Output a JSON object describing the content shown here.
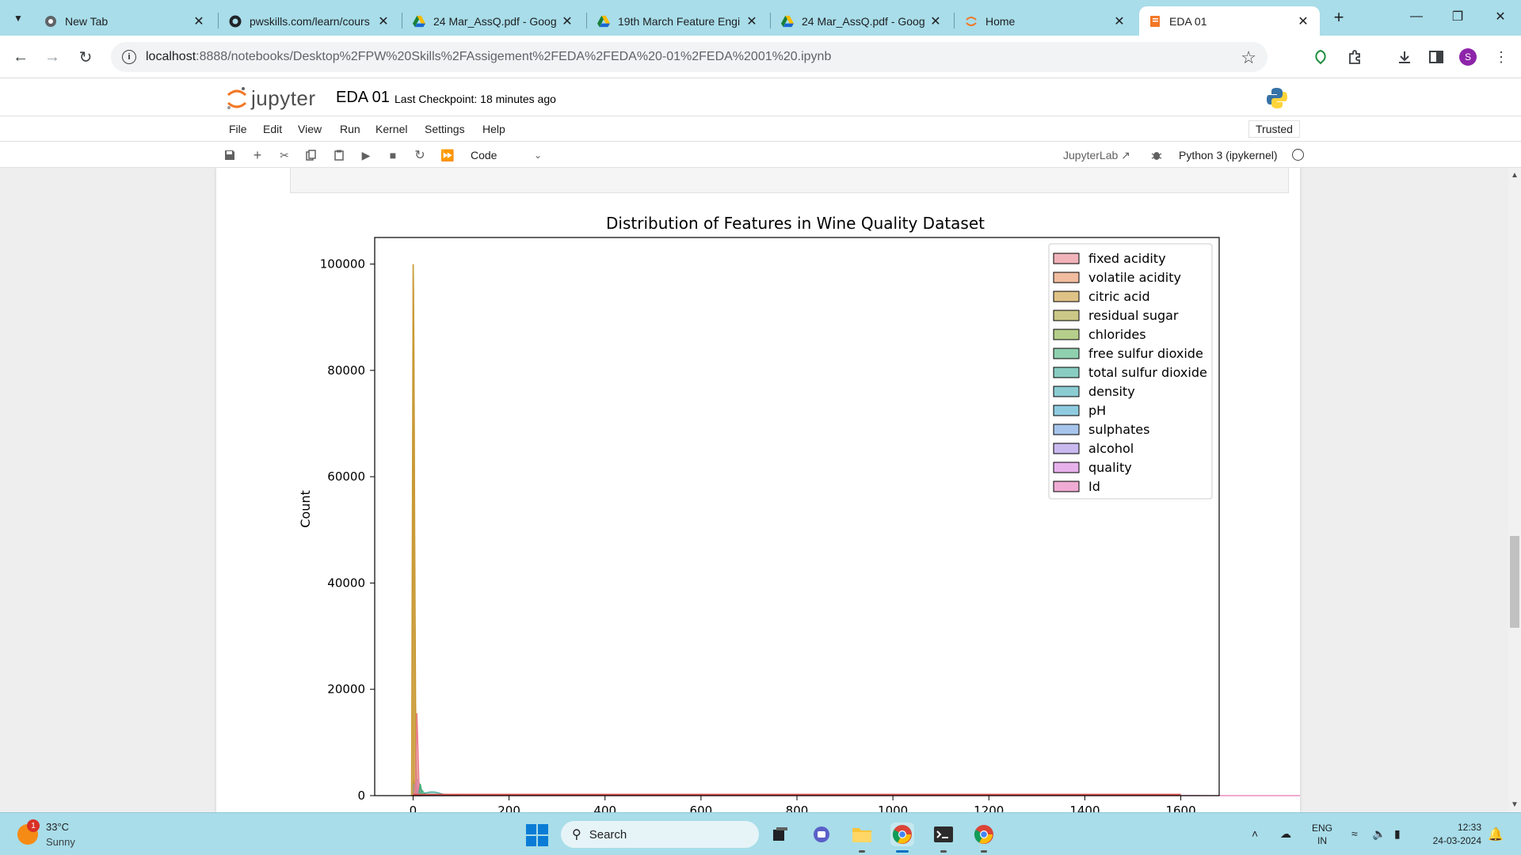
{
  "browser": {
    "tabs": [
      {
        "title": "New Tab",
        "favicon": "chrome-icon",
        "active": false
      },
      {
        "title": "pwskills.com/learn/cours",
        "favicon": "github-icon",
        "active": false
      },
      {
        "title": "24 Mar_AssQ.pdf - Goog",
        "favicon": "drive-icon",
        "active": false
      },
      {
        "title": "19th March Feature Engi",
        "favicon": "drive-icon",
        "active": false
      },
      {
        "title": "24 Mar_AssQ.pdf - Goog",
        "favicon": "drive-icon",
        "active": false
      },
      {
        "title": "Home",
        "favicon": "jupyter-icon",
        "active": false
      },
      {
        "title": "EDA 01",
        "favicon": "notebook-icon",
        "active": true
      }
    ],
    "url_host": "localhost",
    "url_path": ":8888/notebooks/Desktop%2FPW%20Skills%2FAssigement%2FEDA%2FEDA%20-01%2FEDA%2001%20.ipynb",
    "profile_initial": "S"
  },
  "jupyter": {
    "logo_text": "jupyter",
    "notebook_title": "EDA 01",
    "checkpoint": "Last Checkpoint: 18 minutes ago",
    "menu": [
      "File",
      "Edit",
      "View",
      "Run",
      "Kernel",
      "Settings",
      "Help"
    ],
    "trusted": "Trusted",
    "cell_type": "Code",
    "jupyterlab_link": "JupyterLab",
    "kernel": "Python 3 (ipykernel)"
  },
  "chart_data": {
    "type": "area",
    "title": "Distribution of Features in Wine Quality Dataset",
    "xlabel": "",
    "ylabel": "Count",
    "xlim": [
      -80,
      1680
    ],
    "ylim": [
      0,
      105000
    ],
    "xticks": [
      0,
      200,
      400,
      600,
      800,
      1000,
      1200,
      1400,
      1600
    ],
    "yticks": [
      0,
      20000,
      40000,
      60000,
      80000,
      100000
    ],
    "legend_position": "top-right",
    "series": [
      {
        "name": "fixed acidity",
        "color": "#e8808c",
        "peak_x": 8,
        "peak_y": 1800
      },
      {
        "name": "volatile acidity",
        "color": "#e89060",
        "peak_x": 0.6,
        "peak_y": 3000
      },
      {
        "name": "citric acid",
        "color": "#c99a35",
        "peak_x": 0.3,
        "peak_y": 100000
      },
      {
        "name": "residual sugar",
        "color": "#a9a337",
        "peak_x": 2.5,
        "peak_y": 2500
      },
      {
        "name": "chlorides",
        "color": "#85ae3e",
        "peak_x": 0.08,
        "peak_y": 2000
      },
      {
        "name": "free sulfur dioxide",
        "color": "#44b07a",
        "peak_x": 15,
        "peak_y": 1200
      },
      {
        "name": "total sulfur dioxide",
        "color": "#3aaa99",
        "peak_x": 40,
        "peak_y": 700
      },
      {
        "name": "density",
        "color": "#3eaab5",
        "peak_x": 1,
        "peak_y": 1500
      },
      {
        "name": "pH",
        "color": "#45a8cc",
        "peak_x": 3.3,
        "peak_y": 2000
      },
      {
        "name": "sulphates",
        "color": "#6d9ee0",
        "peak_x": 0.65,
        "peak_y": 2200
      },
      {
        "name": "alcohol",
        "color": "#a58be5",
        "peak_x": 10,
        "peak_y": 3000
      },
      {
        "name": "quality",
        "color": "#d77de0",
        "peak_x": 6,
        "peak_y": 2500
      },
      {
        "name": "Id",
        "color": "#e674b8",
        "peak_x": 800,
        "peak_y": 200
      }
    ],
    "spike_series": [
      {
        "ref": "citric acid",
        "x": 0,
        "y": 100000
      },
      {
        "ref": "fixed acidity",
        "x": 8,
        "y": 15500
      },
      {
        "ref": "free sulfur dioxide",
        "x": 15,
        "y": 2200
      }
    ]
  },
  "taskbar": {
    "weather_temp": "33°C",
    "weather_desc": "Sunny",
    "weather_badge": "1",
    "search_label": "Search",
    "lang_line1": "ENG",
    "lang_line2": "IN",
    "time": "12:33",
    "date": "24-03-2024"
  }
}
